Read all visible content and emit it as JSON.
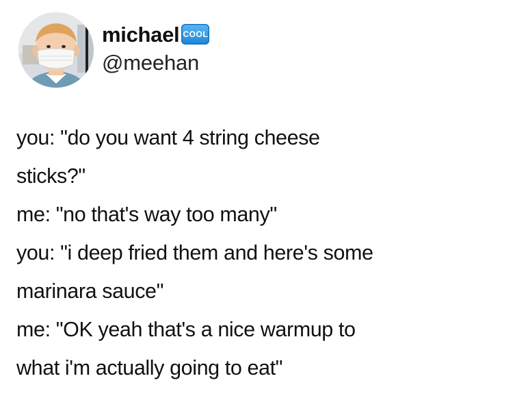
{
  "tweet": {
    "author": {
      "display_name": "michael",
      "badge_text": "COOL",
      "handle": "@meehan",
      "avatar_icon": "cartoon-character-with-face-mask"
    },
    "lines": [
      "you: \"do you want 4 string cheese",
      "sticks?\"",
      "me: \"no that's way too many\"",
      "you: \"i deep fried them and here's some",
      "marinara sauce\"",
      "me: \"OK yeah that's a nice warmup to",
      "what i'm actually going to eat\""
    ]
  },
  "colors": {
    "text": "#111111",
    "badge": "#1b84d9",
    "background": "#ffffff"
  }
}
